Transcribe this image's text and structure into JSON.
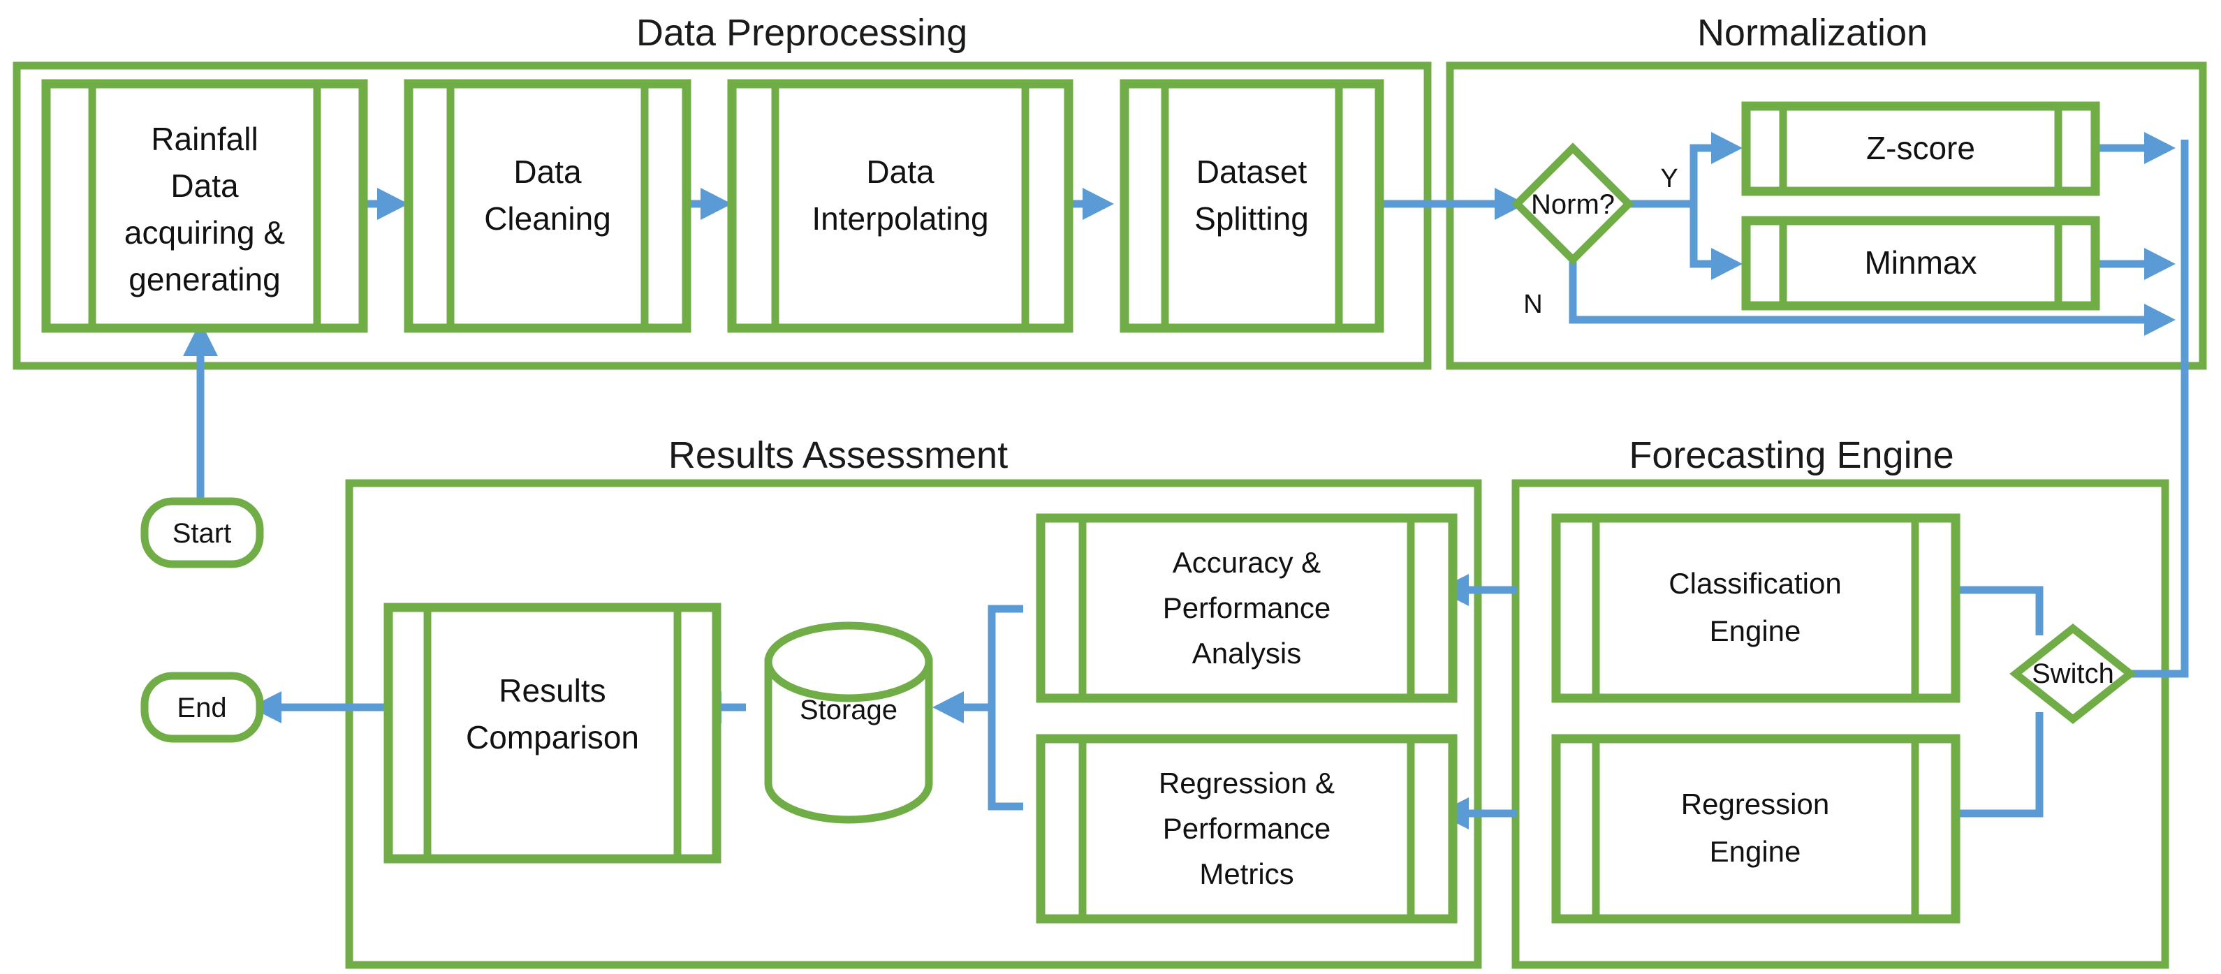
{
  "diagram": {
    "title_font_color": "#1a1a1a",
    "accent_green": "#70ad47",
    "accent_blue": "#5b9bd5",
    "groups": [
      {
        "id": "data_preprocessing",
        "title": "Data Preprocessing"
      },
      {
        "id": "normalization",
        "title": "Normalization"
      },
      {
        "id": "results_assessment",
        "title": "Results Assessment"
      },
      {
        "id": "forecasting_engine",
        "title": "Forecasting Engine"
      }
    ],
    "terminators": {
      "start": "Start",
      "end": "End"
    },
    "preprocessing_nodes": [
      {
        "id": "rainfall",
        "label_lines": [
          "Rainfall",
          "Data",
          "acquiring &",
          "generating"
        ]
      },
      {
        "id": "cleaning",
        "label_lines": [
          "Data",
          "Cleaning"
        ]
      },
      {
        "id": "interpolating",
        "label_lines": [
          "Data",
          "Interpolating"
        ]
      },
      {
        "id": "splitting",
        "label_lines": [
          "Dataset",
          "Splitting"
        ]
      }
    ],
    "normalization_nodes": [
      {
        "id": "zscore",
        "label_lines": [
          "Z-score"
        ]
      },
      {
        "id": "minmax",
        "label_lines": [
          "Minmax"
        ]
      }
    ],
    "forecasting_nodes": [
      {
        "id": "classification",
        "label_lines": [
          "Classification",
          "Engine"
        ]
      },
      {
        "id": "regression",
        "label_lines": [
          "Regression",
          "Engine"
        ]
      }
    ],
    "assessment_nodes": [
      {
        "id": "accuracy",
        "label_lines": [
          "Accuracy &",
          "Performance",
          "Analysis"
        ]
      },
      {
        "id": "regression_metrics",
        "label_lines": [
          "Regression &",
          "Performance",
          "Metrics"
        ]
      },
      {
        "id": "results_comparison",
        "label_lines": [
          "Results",
          "Comparison"
        ]
      }
    ],
    "storage": {
      "id": "storage",
      "label": "Storage"
    },
    "decisions": [
      {
        "id": "norm_decision",
        "label": "Norm?"
      },
      {
        "id": "switch_decision",
        "label": "Switch"
      }
    ],
    "edge_labels": {
      "norm_yes": "Y",
      "norm_no": "N"
    }
  }
}
